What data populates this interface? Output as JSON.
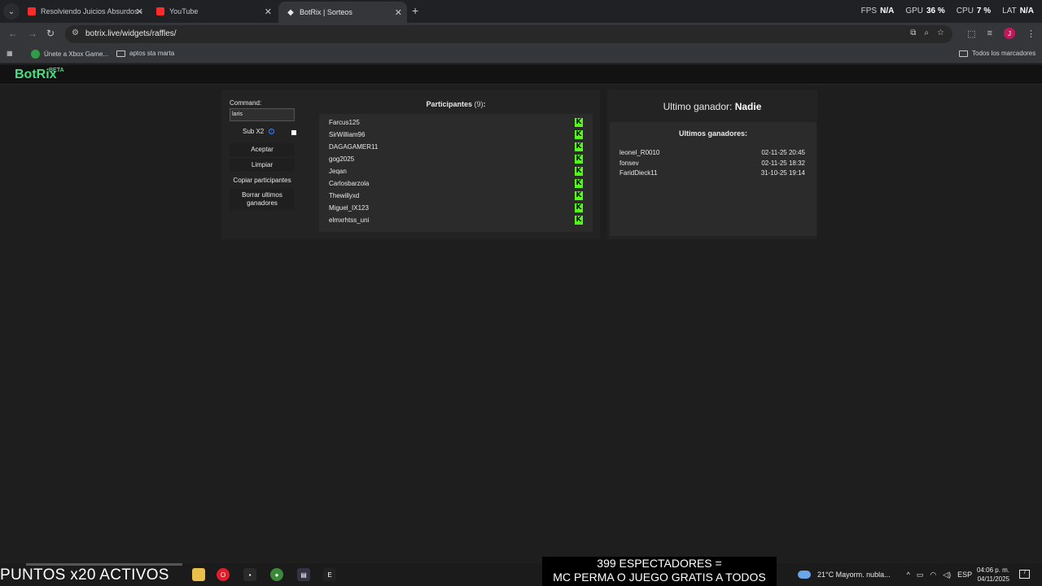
{
  "browser": {
    "tabs": [
      {
        "label": "Resolviendo Juicios Absurdos -",
        "favicon": "youtube-icon",
        "active": false
      },
      {
        "label": "YouTube",
        "favicon": "youtube-icon",
        "active": false
      },
      {
        "label": "BotRix | Sorteos",
        "favicon": "botrix-icon",
        "active": true
      }
    ],
    "stats": [
      {
        "label": "FPS",
        "value": "N/A"
      },
      {
        "label": "GPU",
        "value": "36 %"
      },
      {
        "label": "CPU",
        "value": "7 %"
      },
      {
        "label": "LAT",
        "value": "N/A"
      }
    ],
    "url": "botrix.live/widgets/raffles/",
    "bookmarks": [
      {
        "label": "Únete a Xbox Game...",
        "icon": "xbox-icon"
      },
      {
        "label": "aptos sta marta",
        "icon": "folder-icon"
      }
    ],
    "all_bookmarks": "Todos los marcadores",
    "profile_initial": "J"
  },
  "app": {
    "logo": "BotRix",
    "logo_badge": "BETA",
    "command_label": "Command:",
    "command_value": "laris",
    "sub_label": "Sub X2",
    "buttons": {
      "accept": "Aceptar",
      "clear": "Limpiar",
      "copy": "Copiar participantes",
      "delete": "Borrar ultimos ganadores"
    },
    "participants_title": "Participantes",
    "participants_count": "(9)",
    "participants_colon": ":",
    "participants": [
      "Farcus125",
      "SirWilliam96",
      "DAGAGAMER11",
      "gog2025",
      "Jeqan",
      "Carlosbarzola",
      "Thewillyxd",
      "Miguel_IX123",
      "elmxrhtss_uni"
    ],
    "last_winner_label": "Ultimo ganador:",
    "last_winner_value": "Nadie",
    "winners_title": "Ultimos ganadores:",
    "winners": [
      {
        "name": "leonel_R0010",
        "date": "02-11-25 20:45"
      },
      {
        "name": "fonsev",
        "date": "02-11-25 18:32"
      },
      {
        "name": "FaridDieck11",
        "date": "31-10-25 19:14"
      }
    ]
  },
  "overlay": {
    "points": "PUNTOS x20 ACTIVOS",
    "ticker_line1": "399 ESPECTADORES =",
    "ticker_line2": "MC PERMA O JUEGO GRATIS A TODOS"
  },
  "taskbar": {
    "weather": "21°C  Mayorm. nubla...",
    "language": "ESP",
    "time": "04:06 p. m.",
    "date": "04/11/2025",
    "notifications": "7"
  }
}
